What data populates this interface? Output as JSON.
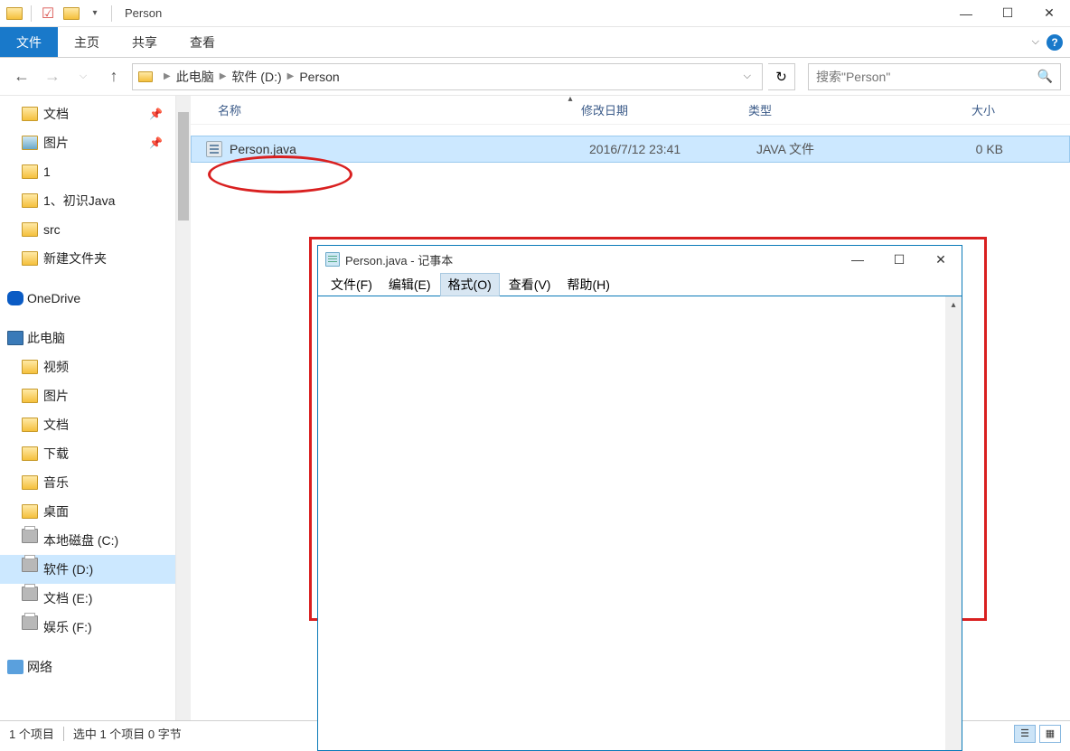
{
  "titlebar": {
    "title": "Person"
  },
  "ribbon": {
    "file": "文件",
    "home": "主页",
    "share": "共享",
    "view": "查看"
  },
  "breadcrumb": {
    "parts": [
      "此电脑",
      "软件 (D:)",
      "Person"
    ]
  },
  "search": {
    "placeholder": "搜索\"Person\""
  },
  "sidebar": {
    "items": [
      {
        "label": "文档",
        "pinned": true
      },
      {
        "label": "图片",
        "pinned": true
      },
      {
        "label": "1"
      },
      {
        "label": "1、初识Java"
      },
      {
        "label": "src"
      },
      {
        "label": "新建文件夹"
      }
    ],
    "onedrive": "OneDrive",
    "thispc": "此电脑",
    "pc_items": [
      {
        "label": "视频"
      },
      {
        "label": "图片"
      },
      {
        "label": "文档"
      },
      {
        "label": "下载"
      },
      {
        "label": "音乐"
      },
      {
        "label": "桌面"
      }
    ],
    "drives": [
      {
        "label": "本地磁盘 (C:)"
      },
      {
        "label": "软件 (D:)",
        "selected": true
      },
      {
        "label": "文档 (E:)"
      },
      {
        "label": "娱乐 (F:)"
      }
    ],
    "network": "网络"
  },
  "columns": {
    "name": "名称",
    "date": "修改日期",
    "type": "类型",
    "size": "大小"
  },
  "files": [
    {
      "name": "Person.java",
      "date": "2016/7/12 23:41",
      "type": "JAVA 文件",
      "size": "0 KB"
    }
  ],
  "status": {
    "count": "1 个项目",
    "selection": "选中 1 个项目 0 字节"
  },
  "notepad": {
    "title": "Person.java - 记事本",
    "menu": {
      "file": "文件(F)",
      "edit": "编辑(E)",
      "format": "格式(O)",
      "view": "查看(V)",
      "help": "帮助(H)"
    }
  }
}
